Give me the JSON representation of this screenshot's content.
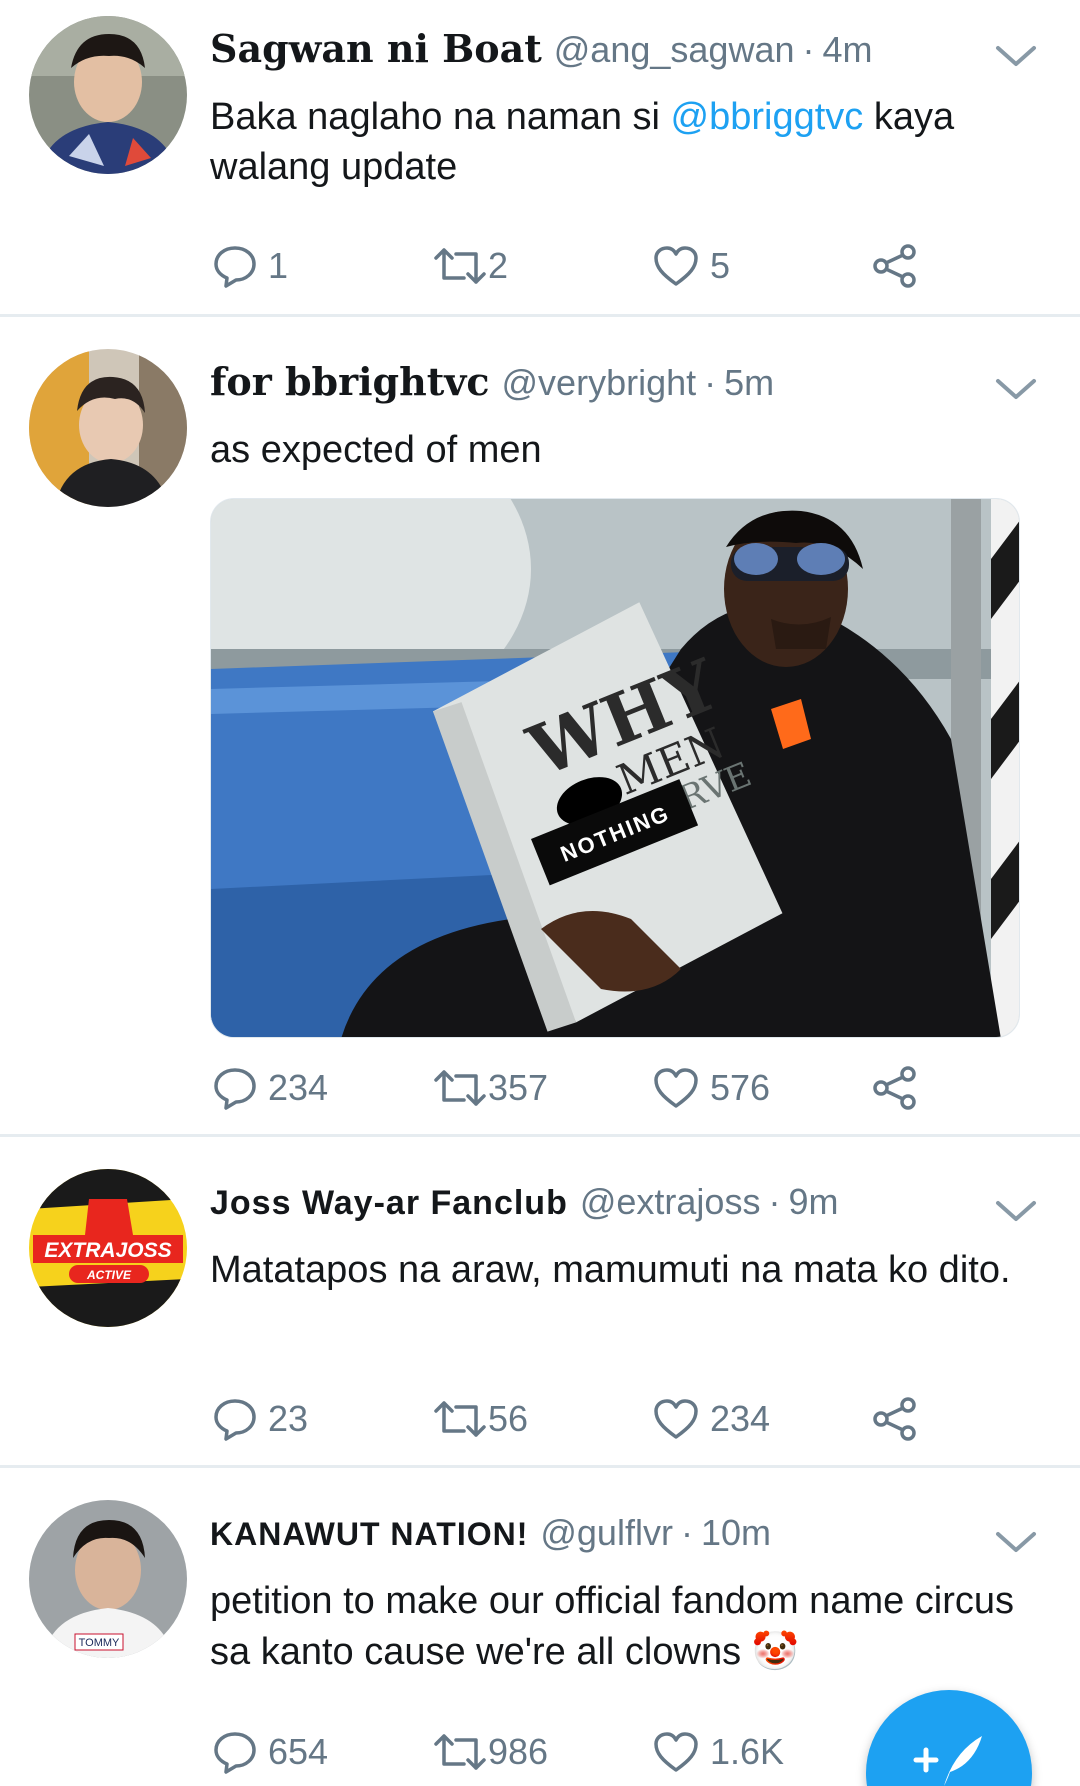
{
  "colors": {
    "accent": "#1da1f2",
    "muted": "#657786",
    "divider": "#e6ecf0"
  },
  "tweets": [
    {
      "name": "Sagwan ni Boat",
      "handle": "@ang_sagwan",
      "sep": "·",
      "time": "4m",
      "text_before": "Baka naglaho na naman si ",
      "mention": "@bbriggtvc",
      "text_after": " kaya walang update",
      "replies": "1",
      "retweets": "2",
      "likes": "5"
    },
    {
      "name": "for bbrightvc",
      "handle": "@verybright",
      "sep": "·",
      "time": "5m",
      "text": "as expected of men",
      "media": {
        "book_title_1": "WHY",
        "book_title_2": "MEN",
        "book_title_3": "DESERVE",
        "book_label": "NOTHING"
      },
      "replies": "234",
      "retweets": "357",
      "likes": "576"
    },
    {
      "name": "Joss Way-ar Fanclub",
      "handle": "@extrajoss",
      "sep": "·",
      "time": "9m",
      "text": "Matatapos na araw, mamumuti na mata ko dito.",
      "avatar_text": "EXTRAJOSS",
      "avatar_sub": "ACTIVE",
      "replies": "23",
      "retweets": "56",
      "likes": "234"
    },
    {
      "name": "KANAWUT NATION!",
      "handle": "@gulflvr",
      "sep": "·",
      "time": "10m",
      "text": "petition to make our official fandom name circus sa kanto cause we're all clowns",
      "emoji": "🤡",
      "avatar_text": "TOMMY",
      "replies": "654",
      "retweets": "986",
      "likes": "1.6K"
    }
  ],
  "icons": {
    "reply": "reply-icon",
    "retweet": "retweet-icon",
    "like": "heart-icon",
    "share": "share-icon",
    "more": "chevron-down-icon",
    "compose": "compose-tweet-icon"
  }
}
